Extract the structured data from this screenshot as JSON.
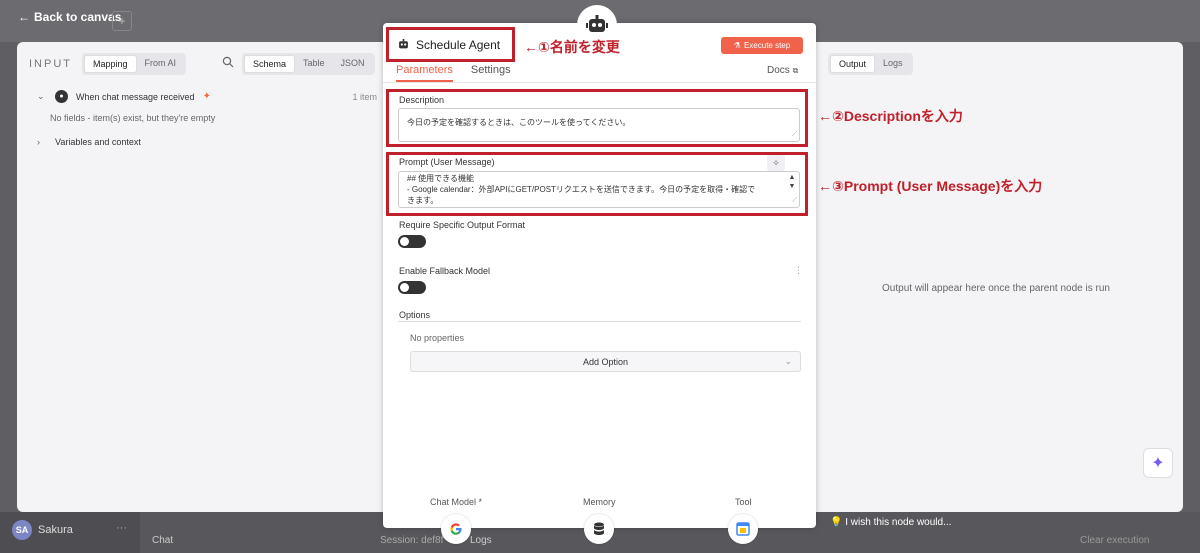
{
  "canvas": {
    "back_label": "Back to canvas",
    "plus_label": "+",
    "user_initials": "SA",
    "user_name": "Sakura",
    "user_more": "···",
    "chat_label": "Chat",
    "session_label": "Session: def8f",
    "logs_label": "Logs",
    "wish_label": "I wish this node would...",
    "clear_label": "Clear execution"
  },
  "input_panel": {
    "title": "INPUT",
    "mode_tabs": [
      "Mapping",
      "From AI"
    ],
    "view_tabs": [
      "Schema",
      "Table",
      "JSON"
    ],
    "trigger_name": "When chat message received",
    "item_count": "1 item",
    "no_fields": "No fields - item(s) exist, but they're empty",
    "variables": "Variables and context"
  },
  "output_panel": {
    "tabs": [
      "Output",
      "Logs"
    ],
    "empty_message": "Output will appear here once the parent node is run"
  },
  "node": {
    "name": "Schedule Agent",
    "execute_label": "Execute step",
    "tabs": [
      "Parameters",
      "Settings"
    ],
    "docs_label": "Docs"
  },
  "fields": {
    "description_label": "Description",
    "description_value": "今日の予定を確認するときは、このツールを使ってください。",
    "prompt_label": "Prompt (User Message)",
    "prompt_line1": "## 使用できる機能",
    "prompt_line2": "- Google calendar：外部APIにGET/POSTリクエストを送信できます。今日の予定を取得・確認で",
    "prompt_line3": "きます。",
    "output_format_label": "Require Specific Output Format",
    "fallback_label": "Enable Fallback Model",
    "options_label": "Options",
    "no_properties": "No properties",
    "add_option": "Add Option"
  },
  "sub_nodes": {
    "chat_model": "Chat Model *",
    "memory": "Memory",
    "tool": "Tool"
  },
  "annotations": {
    "a1": "←①名前を変更",
    "a2": "←②Descriptionを入力",
    "a3": "←③Prompt (User Message)を入力"
  },
  "colors": {
    "accent": "#f0624a",
    "annotation_red": "#c0202a"
  }
}
